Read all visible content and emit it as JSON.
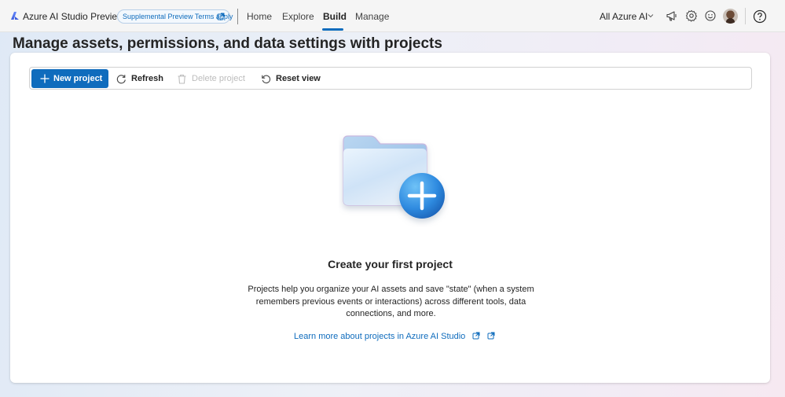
{
  "header": {
    "app_name": "Azure AI Studio",
    "app_suffix": "Preview",
    "terms_badge": "Supplemental Preview Terms apply",
    "nav": [
      {
        "label": "Home"
      },
      {
        "label": "Explore"
      },
      {
        "label": "Build"
      },
      {
        "label": "Manage"
      }
    ],
    "active_nav": "Build",
    "scope_selector": "All Azure AI",
    "icons": [
      "megaphone-icon",
      "gear-icon",
      "smiley-icon",
      "avatar",
      "help-icon"
    ]
  },
  "page": {
    "title": "Manage assets, permissions, and data settings with projects"
  },
  "toolbar": {
    "new_project": "New project",
    "refresh": "Refresh",
    "delete_project": "Delete project",
    "reset_view": "Reset view"
  },
  "empty_state": {
    "title": "Create your first project",
    "description": "Projects help you organize your AI assets and save \"state\" (when a system remembers previous events or interactions) across different tools, data connections, and more.",
    "link": "Learn more about projects in Azure AI Studio"
  },
  "colors": {
    "accent": "#0f6cbd",
    "disabled_text": "#bdbdbd"
  }
}
